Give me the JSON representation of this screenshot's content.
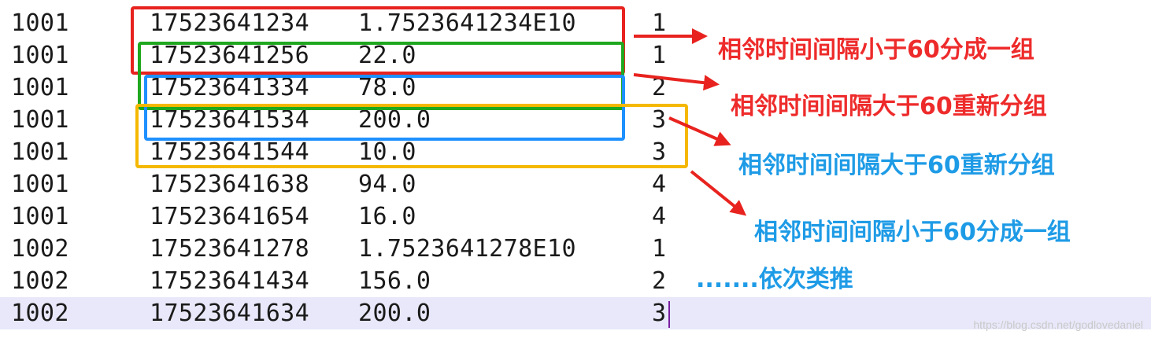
{
  "editor": {
    "rows": [
      {
        "id": "1001",
        "ts": "17523641234",
        "val": "1.7523641234E10",
        "grp": "1"
      },
      {
        "id": "1001",
        "ts": "17523641256",
        "val": "22.0",
        "grp": "1"
      },
      {
        "id": "1001",
        "ts": "17523641334",
        "val": "78.0",
        "grp": "2"
      },
      {
        "id": "1001",
        "ts": "17523641534",
        "val": "200.0",
        "grp": "3"
      },
      {
        "id": "1001",
        "ts": "17523641544",
        "val": "10.0",
        "grp": "3"
      },
      {
        "id": "1001",
        "ts": "17523641638",
        "val": "94.0",
        "grp": "4"
      },
      {
        "id": "1001",
        "ts": "17523641654",
        "val": "16.0",
        "grp": "4"
      },
      {
        "id": "1002",
        "ts": "17523641278",
        "val": "1.7523641278E10",
        "grp": "1"
      },
      {
        "id": "1002",
        "ts": "17523641434",
        "val": "156.0",
        "grp": "2"
      },
      {
        "id": "1002",
        "ts": "17523641634",
        "val": "200.0",
        "grp": "3"
      }
    ],
    "current_row": 10
  },
  "annotations": [
    {
      "text": "相邻时间间隔小于60分成一组",
      "color": "#ee2b2b",
      "box_color": "#e8231f",
      "box_label": "red"
    },
    {
      "text": "相邻时间间隔大于60重新分组",
      "color": "#ee2b2b",
      "box_color": "#1fa81f",
      "box_label": "green"
    },
    {
      "text": "相邻时间间隔大于60重新分组",
      "color": "#1e9be6",
      "box_color": "#1e90ff",
      "box_label": "blue"
    },
    {
      "text": "相邻时间间隔小于60分成一组",
      "color": "#1e9be6",
      "box_color": "#f5b800",
      "box_label": "yellow"
    }
  ],
  "etc_note": {
    "text": ".......依次类推",
    "color": "#1e9be6"
  },
  "arrow_color": "#e8231f",
  "watermark": "https://blog.csdn.net/godlovedaniel"
}
